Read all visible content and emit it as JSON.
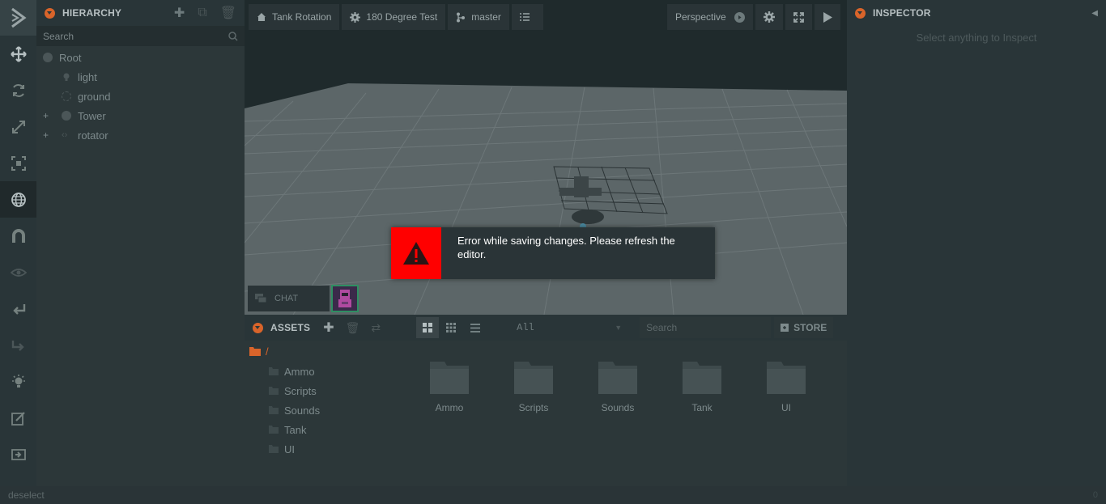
{
  "hierarchy": {
    "title": "HIERARCHY",
    "search_placeholder": "Search",
    "items": [
      {
        "label": "Root",
        "expander": ""
      },
      {
        "label": "light",
        "expander": ""
      },
      {
        "label": "ground",
        "expander": ""
      },
      {
        "label": "Tower",
        "expander": "+"
      },
      {
        "label": "rotator",
        "expander": "+"
      }
    ]
  },
  "toolbar": {
    "tools": [
      "translate-icon",
      "rotate-icon",
      "scale-icon",
      "resize-icon",
      "world-icon",
      "snap-icon",
      "view-icon",
      "undo-icon",
      "redo-icon",
      "lightmapper-icon",
      "code-editor-icon",
      "publish-icon"
    ]
  },
  "viewport": {
    "project_name": "Tank Rotation",
    "scene_name": "180 Degree Test",
    "branch": "master",
    "camera": "Perspective",
    "chat_label": "CHAT"
  },
  "toast": {
    "message": "Error while saving changes. Please refresh the editor."
  },
  "assets": {
    "title": "ASSETS",
    "filter_value": "All",
    "search_placeholder": "Search",
    "store_label": "STORE",
    "root_path": "/",
    "folders": [
      "Ammo",
      "Scripts",
      "Sounds",
      "Tank",
      "UI"
    ]
  },
  "inspector": {
    "title": "INSPECTOR",
    "empty_message": "Select anything to Inspect"
  },
  "status": {
    "text": "deselect",
    "counter": "0"
  },
  "colors": {
    "accent": "#d9642a",
    "error": "#ff0000",
    "panel": "#2c3739",
    "header": "#293538"
  }
}
